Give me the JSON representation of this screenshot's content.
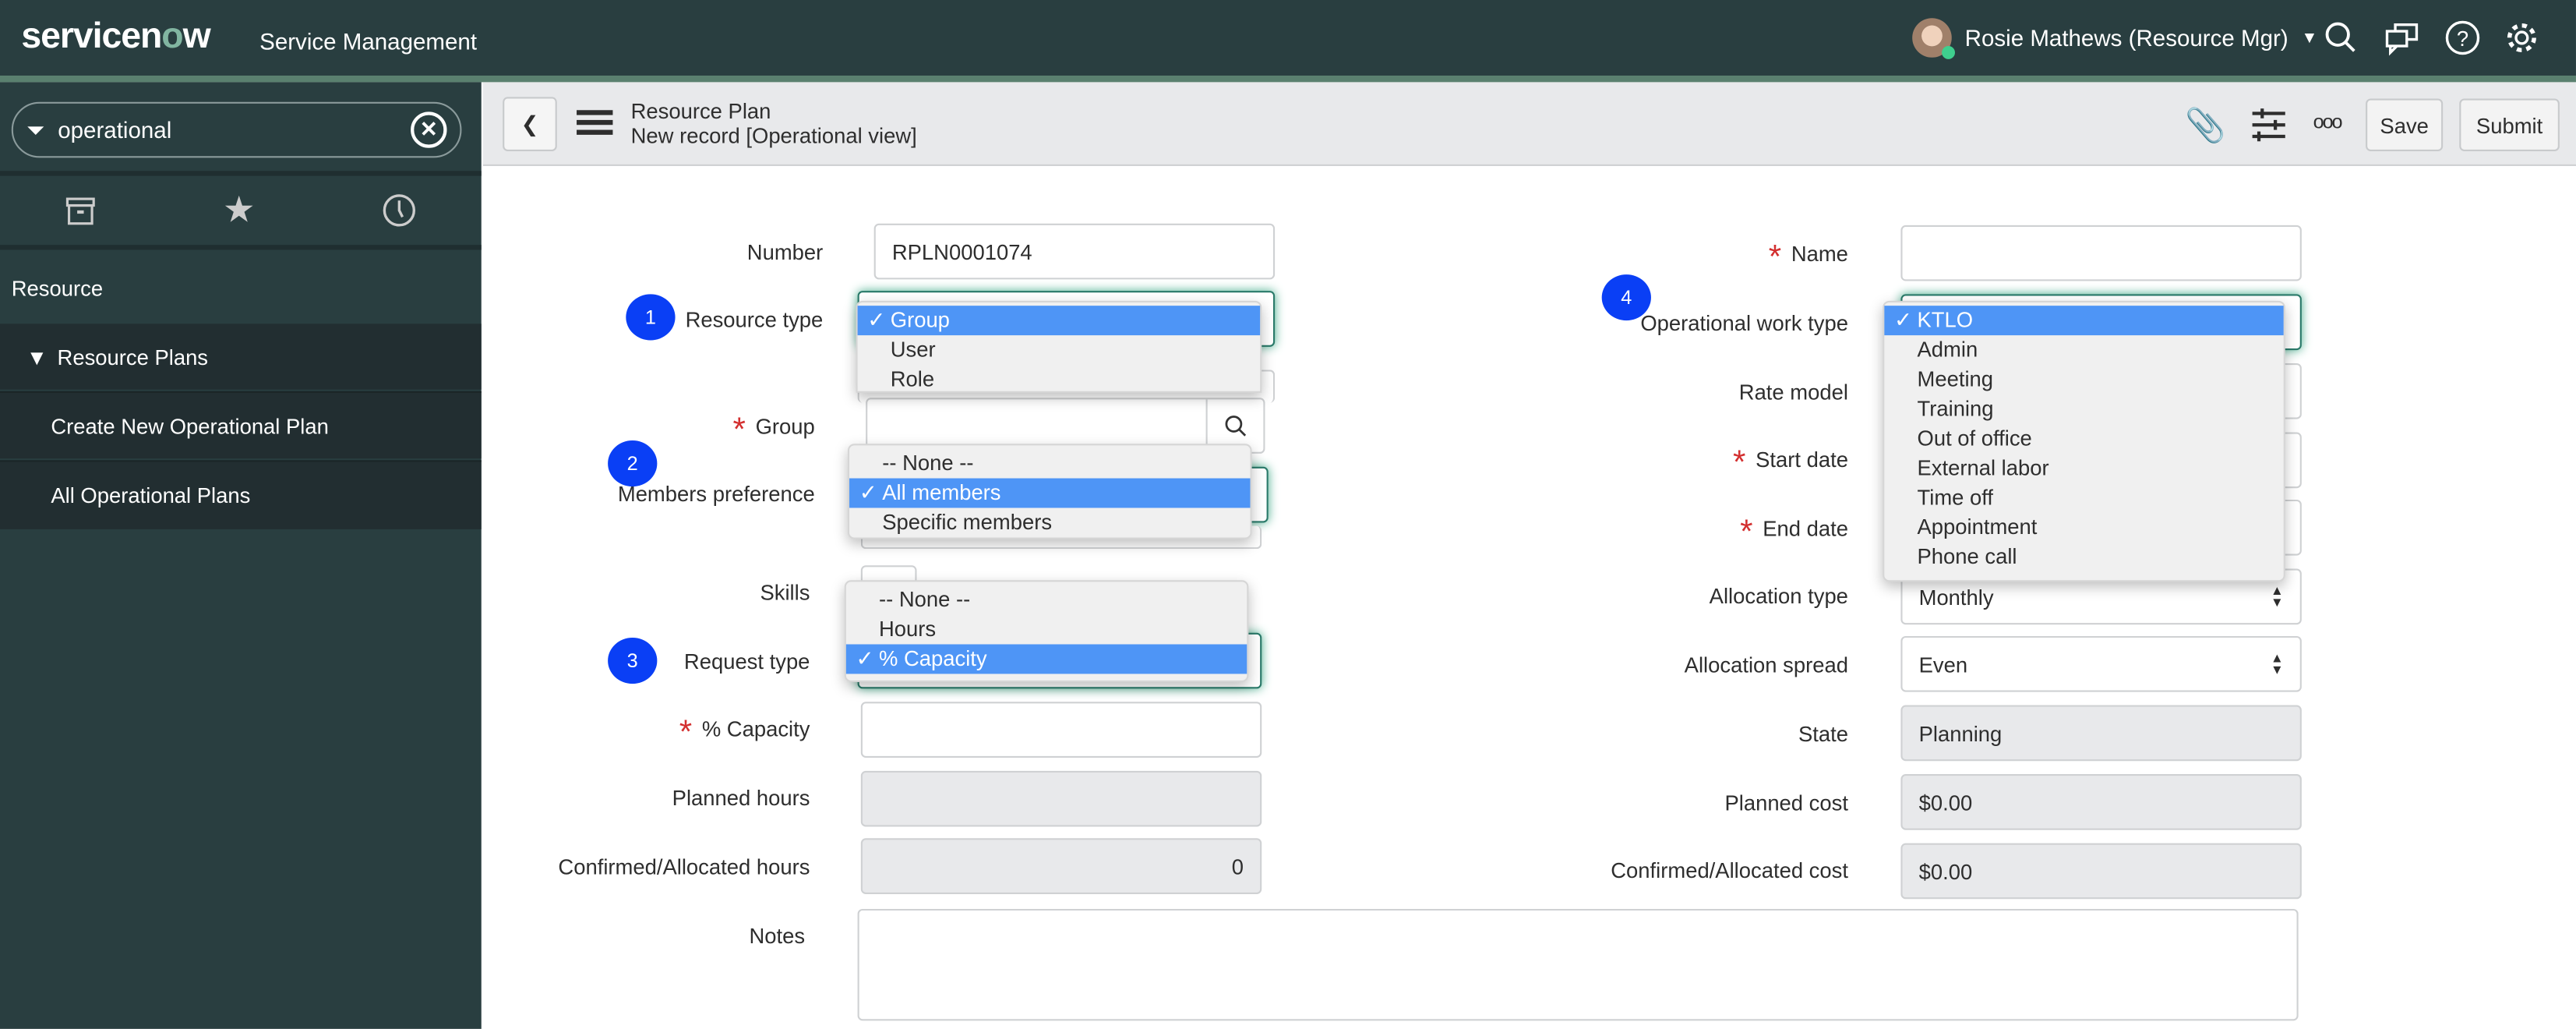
{
  "header": {
    "logo": "servicenow",
    "product": "Service Management",
    "user": "Rosie Mathews (Resource Mgr)",
    "icons": [
      "search-icon",
      "chat-icon",
      "help-icon",
      "gear-icon"
    ]
  },
  "sidebar": {
    "filter_value": "operational",
    "tabs": [
      "archive-icon",
      "star-icon",
      "clock-icon"
    ],
    "items": [
      {
        "label": "Resource"
      },
      {
        "label": "Resource Plans"
      },
      {
        "label": "Create New Operational Plan"
      },
      {
        "label": "All Operational Plans"
      }
    ]
  },
  "toolbar": {
    "title": "Resource Plan",
    "subtitle": "New record [Operational view]",
    "save": "Save",
    "submit": "Submit"
  },
  "form": {
    "left": {
      "number_label": "Number",
      "number": "RPLN0001074",
      "resource_type_label": "Resource type",
      "group_label": "Group",
      "members_label": "Members preference",
      "skills_label": "Skills",
      "request_type_label": "Request type",
      "capacity_label": "% Capacity",
      "planned_hours_label": "Planned hours",
      "confirmed_hours_label": "Confirmed/Allocated hours",
      "confirmed_hours": "0",
      "notes_label": "Notes"
    },
    "right": {
      "name_label": "Name",
      "work_type_label": "Operational work type",
      "rate_model_label": "Rate model",
      "start_label": "Start date",
      "end_label": "End date",
      "alloc_type_label": "Allocation type",
      "alloc_type": "Monthly",
      "alloc_spread_label": "Allocation spread",
      "alloc_spread": "Even",
      "state_label": "State",
      "state": "Planning",
      "planned_cost_label": "Planned cost",
      "planned_cost": "$0.00",
      "confirmed_cost_label": "Confirmed/Allocated cost",
      "confirmed_cost": "$0.00"
    }
  },
  "dropdowns": {
    "resource_type": {
      "options": [
        "Group",
        "User",
        "Role"
      ],
      "selected": "Group"
    },
    "members": {
      "options": [
        "-- None --",
        "All members",
        "Specific members"
      ],
      "selected": "All members"
    },
    "request_type": {
      "options": [
        "-- None --",
        "Hours",
        "% Capacity"
      ],
      "selected": "% Capacity"
    },
    "work_type": {
      "options": [
        "KTLO",
        "Admin",
        "Meeting",
        "Training",
        "Out of office",
        "External labor",
        "Time off",
        "Appointment",
        "Phone call"
      ],
      "selected": "KTLO"
    }
  },
  "badges": [
    "1",
    "2",
    "3",
    "4"
  ],
  "colors": {
    "header": "#293e40",
    "accent": "#81b5a1",
    "selection": "#4e95f6",
    "badge": "#0a3ff5",
    "required": "#d32f2f"
  }
}
